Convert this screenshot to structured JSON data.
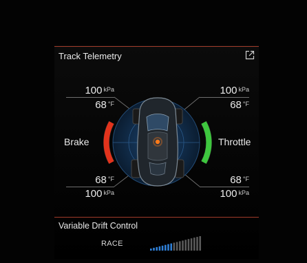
{
  "panel": {
    "title": "Track Telemetry",
    "expand_icon": "external-link-icon"
  },
  "tires": {
    "front_left": {
      "pressure": "100",
      "pressure_unit": "kPa",
      "temp": "68",
      "temp_unit": "°F"
    },
    "front_right": {
      "pressure": "100",
      "pressure_unit": "kPa",
      "temp": "68",
      "temp_unit": "°F"
    },
    "rear_left": {
      "temp": "68",
      "temp_unit": "°F",
      "pressure": "100",
      "pressure_unit": "kPa"
    },
    "rear_right": {
      "temp": "68",
      "temp_unit": "°F",
      "pressure": "100",
      "pressure_unit": "kPa"
    }
  },
  "pedals": {
    "brake_label": "Brake",
    "throttle_label": "Throttle",
    "brake_color": "#e2331c",
    "throttle_color": "#3ec63e"
  },
  "vdc": {
    "title": "Variable Drift Control",
    "mode": "RACE",
    "level": 0.45,
    "active_color": "#2f7fd6",
    "inactive_color": "#5a5a5a"
  },
  "colors": {
    "accent_rule": "#b2412e",
    "radar": "#1c3f66"
  }
}
